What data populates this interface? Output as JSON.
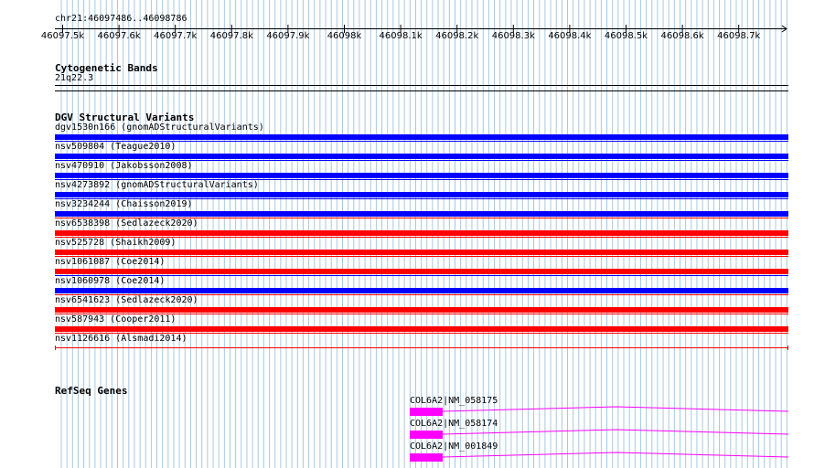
{
  "ruler": {
    "position": "chr21:46097486..46098786",
    "ticks": [
      "46097.5k",
      "46097.6k",
      "46097.7k",
      "46097.8k",
      "46097.9k",
      "46098k",
      "46098.1k",
      "46098.2k",
      "46098.3k",
      "46098.4k",
      "46098.5k",
      "46098.6k",
      "46098.7k"
    ]
  },
  "cytobands": {
    "title": "Cytogenetic Bands",
    "band": "21q22.3"
  },
  "dgv": {
    "title": "DGV Structural Variants",
    "variants": [
      {
        "label": "dgv1530n166 (gnomADStructuralVariants)",
        "type": "loss"
      },
      {
        "label": "nsv509804 (Teague2010)",
        "type": "loss"
      },
      {
        "label": "nsv470910 (Jakobsson2008)",
        "type": "loss"
      },
      {
        "label": "nsv4273892 (gnomADStructuralVariants)",
        "type": "loss"
      },
      {
        "label": "nsv3234244 (Chaisson2019)",
        "type": "loss"
      },
      {
        "label": "nsv6538398 (Sedlazeck2020)",
        "type": "gain"
      },
      {
        "label": "nsv525728 (Shaikh2009)",
        "type": "gain"
      },
      {
        "label": "nsv1061087 (Coe2014)",
        "type": "gain"
      },
      {
        "label": "nsv1060978 (Coe2014)",
        "type": "loss"
      },
      {
        "label": "nsv6541623 (Sedlazeck2020)",
        "type": "gain"
      },
      {
        "label": "nsv587943 (Cooper2011)",
        "type": "gain"
      },
      {
        "label": "nsv1126616 (Alsmadi2014)",
        "type": "gain"
      }
    ]
  },
  "refseq": {
    "title": "RefSeq Genes",
    "genes": [
      {
        "label": "COL6A2|NM_058175"
      },
      {
        "label": "COL6A2|NM_058174"
      },
      {
        "label": "COL6A2|NM_001849"
      }
    ]
  },
  "colors": {
    "grid": "#a8c8e0",
    "loss": "#0000ff",
    "gain": "#ff0000",
    "gene": "#ff00ff"
  }
}
